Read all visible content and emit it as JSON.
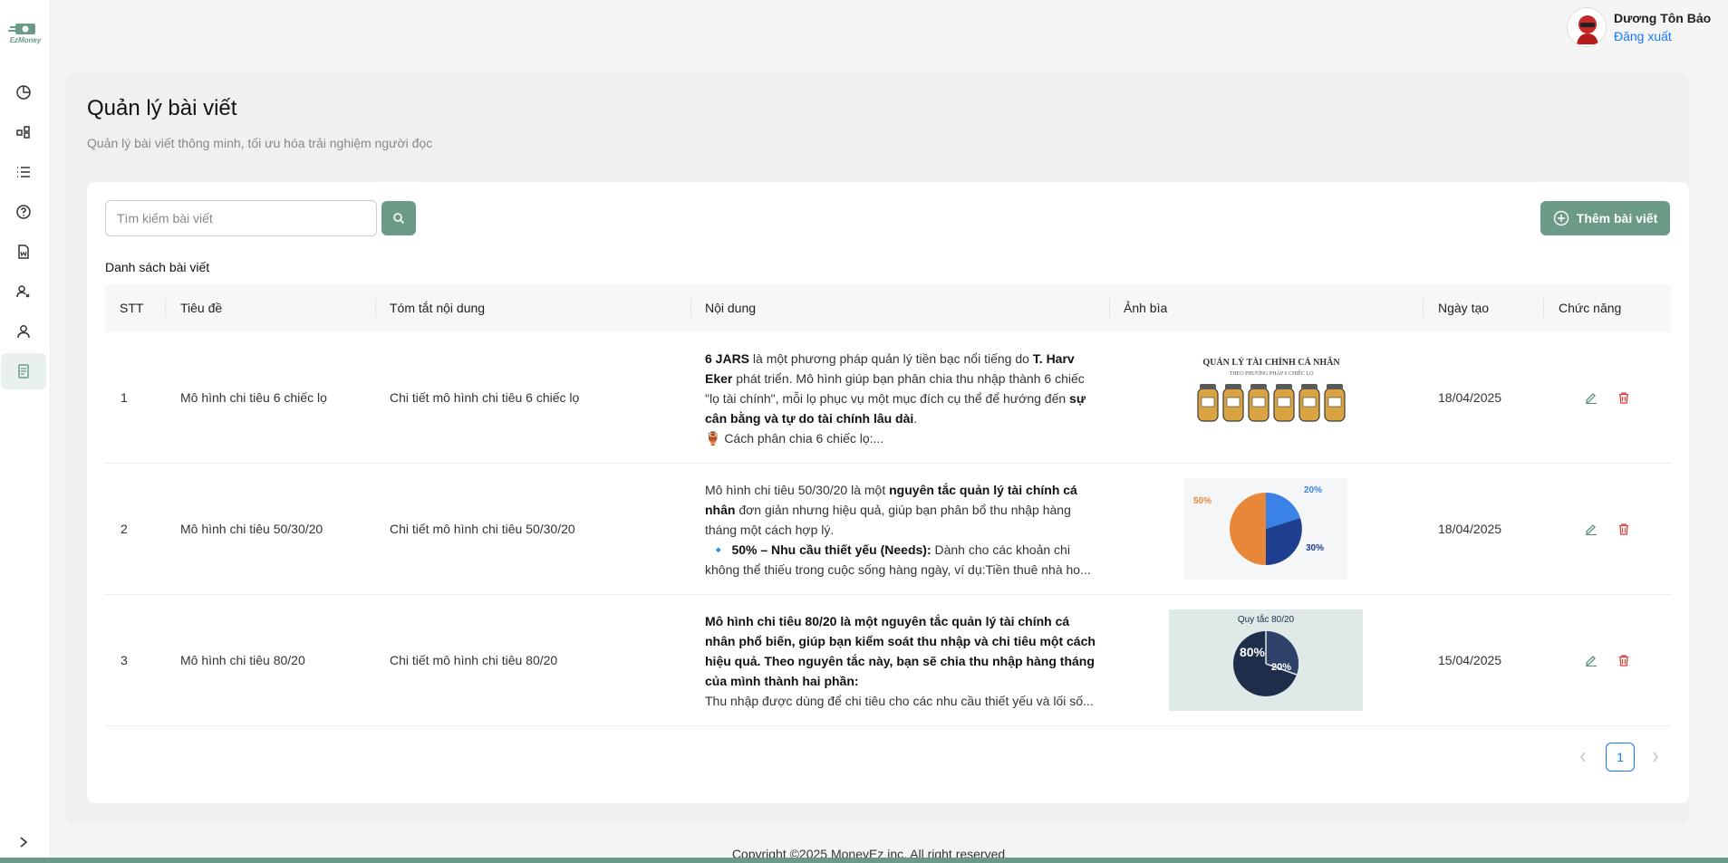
{
  "app": {
    "logo_text": "EzMoney"
  },
  "sidebar": {
    "items": [
      {
        "icon": "pie-chart-icon"
      },
      {
        "icon": "category-icon"
      },
      {
        "icon": "list-icon"
      },
      {
        "icon": "question-icon"
      },
      {
        "icon": "word-file-icon"
      },
      {
        "icon": "users-icon"
      },
      {
        "icon": "user-icon"
      },
      {
        "icon": "article-icon",
        "active": true
      }
    ]
  },
  "user": {
    "name": "Dương Tôn Bảo",
    "logout": "Đăng xuất"
  },
  "page": {
    "title": "Quản lý bài viết",
    "subtitle": "Quản lý bài viết thông minh, tối ưu hóa trải nghiệm người đọc"
  },
  "search": {
    "placeholder": "Tìm kiếm bài viết",
    "value": ""
  },
  "add_button": "Thêm bài viết",
  "list_title": "Danh sách bài viết",
  "table": {
    "headers": {
      "stt": "STT",
      "title": "Tiêu đề",
      "summary": "Tóm tắt nội dung",
      "content": "Nội dung",
      "cover": "Ảnh bìa",
      "date": "Ngày tạo",
      "actions": "Chức năng"
    },
    "rows": [
      {
        "stt": "1",
        "title": "Mô hình chi tiêu 6 chiếc lọ",
        "summary": "Chi tiết mô hình chi tiêu 6 chiếc lọ",
        "content": {
          "p1_b1": "6 JARS",
          "p1_t1": " là một phương pháp quản lý tiền bạc nổi tiếng do ",
          "p1_b2": "T. Harv Eker",
          "p1_t2": " phát triển. Mô hình giúp bạn phân chia thu nhập thành 6 chiếc \"lọ tài chính\", mỗi lọ phục vụ một mục đích cụ thể để hướng đến ",
          "p1_b3": "sự cân bằng và tự do tài chính lâu dài",
          "p1_t3": ".",
          "p2": "🏺 Cách phân chia 6 chiếc lọ:..."
        },
        "cover_title": "QUẢN LÝ TÀI CHÍNH CÁ NHÂN",
        "cover_sub": "THEO PHƯƠNG PHÁP 6 CHIẾC LỌ",
        "date": "18/04/2025"
      },
      {
        "stt": "2",
        "title": "Mô hình chi tiêu 50/30/20",
        "summary": "Chi tiết mô hình chi tiêu 50/30/20",
        "content": {
          "p1_t1": "Mô hình chi tiêu 50/30/20 là một ",
          "p1_b1": "nguyên tắc quản lý tài chính cá nhân",
          "p1_t2": " đơn giản nhưng hiệu quả, giúp bạn phân bổ thu nhập hàng tháng một cách hợp lý.",
          "p2_icon": "🔹",
          "p2_b": "50% – Nhu cầu thiết yếu (Needs):",
          "p2_t": " Dành cho các khoản chi không thể thiếu trong cuộc sống hàng ngày, ví dụ:Tiền thuê nhà ho..."
        },
        "cover_labels": [
          "50%",
          "20%",
          "30%"
        ],
        "date": "18/04/2025"
      },
      {
        "stt": "3",
        "title": "Mô hình chi tiêu 80/20",
        "summary": "Chi tiết mô hình chi tiêu 80/20",
        "content": {
          "p1_b": "Mô hình chi tiêu 80/20 là một nguyên tắc quản lý tài chính cá nhân phổ biến, giúp bạn kiểm soát thu nhập và chi tiêu một cách hiệu quả. Theo nguyên tắc này, bạn sẽ chia thu nhập hàng tháng của mình thành hai phần:",
          "p2": "Thu nhập được dùng để chi tiêu cho các nhu cầu thiết yếu và lối số..."
        },
        "cover_title": "Quy tắc 80/20",
        "cover_labels": [
          "80%",
          "20%"
        ],
        "date": "15/04/2025"
      }
    ]
  },
  "pagination": {
    "current": "1"
  },
  "footer": "Copyright ©2025 MoneyEz inc. All right reserved",
  "colors": {
    "accent": "#6b9a86",
    "link": "#1677ff",
    "edit_icon": "#5a8f76",
    "delete_icon": "#e53935"
  }
}
